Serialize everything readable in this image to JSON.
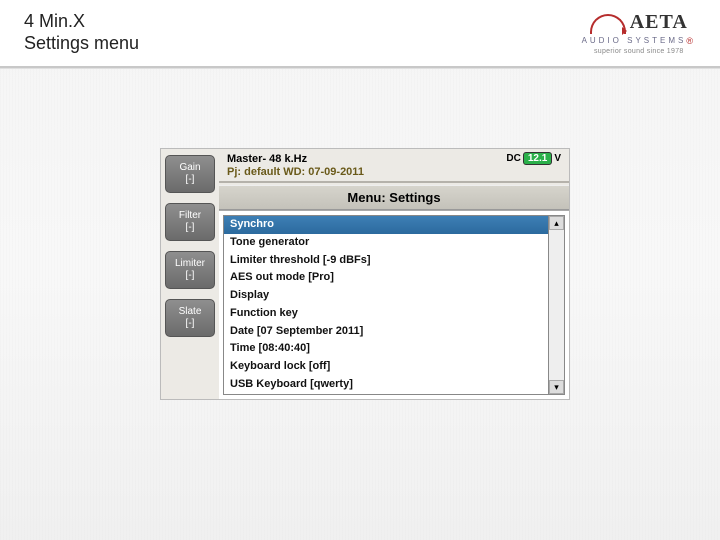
{
  "slide": {
    "title_line1": "4 Min.X",
    "title_line2": "Settings menu"
  },
  "logo": {
    "brand": "AETA",
    "sub": "AUDIO SYSTEMS",
    "reg": "®",
    "tagline": "superior sound since 1978"
  },
  "device": {
    "status": {
      "mode": "Master- 48 k.Hz",
      "dc_label": "DC",
      "dc_value": "12.1",
      "dc_unit": "V"
    },
    "pj_line": "Pj: default  WD: 07-09-2011",
    "menu_title": "Menu: Settings",
    "side_buttons": [
      {
        "label": "Gain",
        "sub": "[-]"
      },
      {
        "label": "Filter",
        "sub": "[-]"
      },
      {
        "label": "Limiter",
        "sub": "[-]"
      },
      {
        "label": "Slate",
        "sub": "[-]"
      }
    ],
    "items": [
      "Synchro",
      "Tone generator",
      "Limiter threshold [-9 dBFs]",
      "AES out mode [Pro]",
      "Display",
      "Function key",
      "Date [07 September 2011]",
      "Time [08:40:40]",
      "Keyboard lock [off]",
      "USB Keyboard [qwerty]"
    ],
    "selected_index": 0,
    "scroll": {
      "up": "▴",
      "down": "▾"
    }
  }
}
